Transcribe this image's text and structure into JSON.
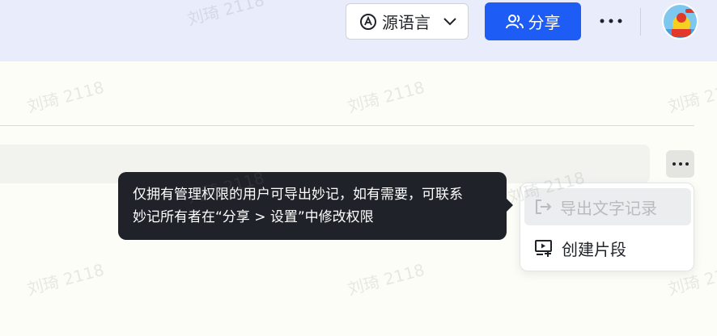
{
  "header": {
    "language_label": "源语言",
    "share_label": "分享"
  },
  "tooltip": {
    "line1": "仅拥有管理权限的用户可导出妙记，如有需要，可联系",
    "line2": "妙记所有者在“分享 > 设置”中修改权限"
  },
  "menu": {
    "items": [
      {
        "label": "导出文字记录",
        "icon": "export-icon",
        "disabled": true
      },
      {
        "label": "创建片段",
        "icon": "create-clip-icon",
        "disabled": false
      }
    ]
  },
  "watermark": "刘琦 2118",
  "colors": {
    "accent": "#1d5cf5",
    "tooltip_bg": "#1f2329",
    "header_bg": "#e8ecfb"
  }
}
